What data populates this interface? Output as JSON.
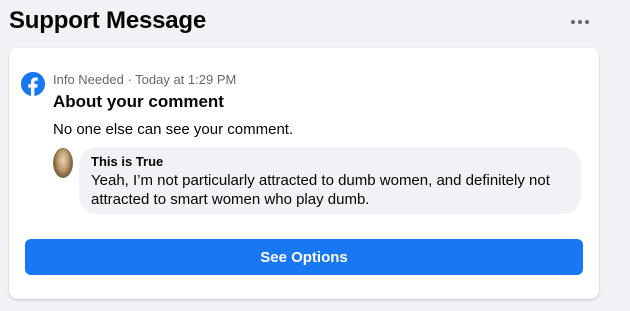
{
  "page": {
    "title": "Support Message",
    "more_icon": "more-horizontal-icon"
  },
  "notification": {
    "icon": "facebook-logo-icon",
    "brand_color": "#1877f2",
    "status": "Info Needed",
    "separator": "·",
    "timestamp": "Today at 1:29 PM",
    "meta": "Info Needed · Today at 1:29 PM",
    "heading": "About your comment",
    "body": "No one else can see your comment.",
    "comment": {
      "author": "This is True",
      "text": "Yeah, I’m not particularly attracted to dumb women, and definitely not attracted to smart women who play dumb."
    },
    "action_label": "See Options"
  }
}
